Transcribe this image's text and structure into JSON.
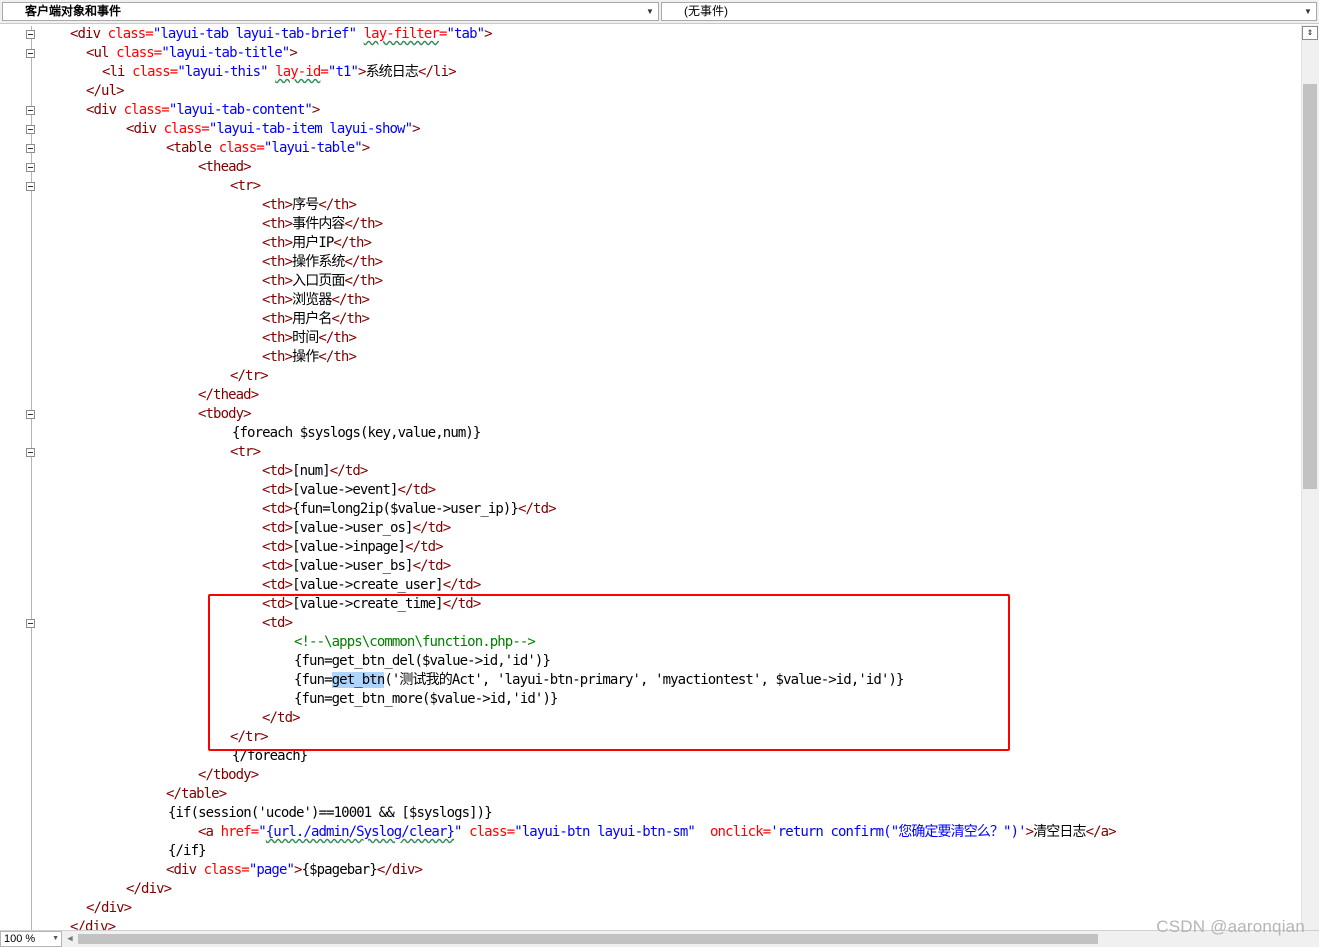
{
  "toolbar": {
    "object_dropdown": "客户端对象和事件",
    "event_dropdown": "(无事件)"
  },
  "editor": {
    "zoom_level": "100 %",
    "lines": [
      [
        [
          "tag",
          "<div "
        ],
        [
          "attr",
          "class="
        ],
        [
          "val",
          "\"layui-tab layui-tab-brief\""
        ],
        [
          "txt-b",
          " "
        ],
        [
          "attr squig",
          "lay-filter"
        ],
        [
          "attr",
          "="
        ],
        [
          "val",
          "\"tab\""
        ],
        [
          "tag",
          ">"
        ]
      ],
      [
        [
          "tag",
          "<ul "
        ],
        [
          "attr",
          "class="
        ],
        [
          "val",
          "\"layui-tab-title\""
        ],
        [
          "tag",
          ">"
        ]
      ],
      [
        [
          "tag",
          "<li "
        ],
        [
          "attr",
          "class="
        ],
        [
          "val",
          "\"layui-this\""
        ],
        [
          "txt-b",
          " "
        ],
        [
          "attr squig",
          "lay-id"
        ],
        [
          "attr",
          "="
        ],
        [
          "val",
          "\"t1\""
        ],
        [
          "tag",
          ">"
        ],
        [
          "txt-b",
          "系统日志"
        ],
        [
          "tag",
          "</li>"
        ]
      ],
      [
        [
          "tag",
          "</ul>"
        ]
      ],
      [
        [
          "tag",
          "<div "
        ],
        [
          "attr",
          "class="
        ],
        [
          "val",
          "\"layui-tab-content\""
        ],
        [
          "tag",
          ">"
        ]
      ],
      [
        [
          "tag",
          "<div "
        ],
        [
          "attr",
          "class="
        ],
        [
          "val",
          "\"layui-tab-item layui-show\""
        ],
        [
          "tag",
          ">"
        ]
      ],
      [
        [
          "tag",
          "<table "
        ],
        [
          "attr",
          "class="
        ],
        [
          "val",
          "\"layui-table\""
        ],
        [
          "tag",
          ">"
        ]
      ],
      [
        [
          "tag",
          "<thead>"
        ]
      ],
      [
        [
          "tag",
          "<tr>"
        ]
      ],
      [
        [
          "tag",
          "<th>"
        ],
        [
          "txt-b",
          "序号"
        ],
        [
          "tag",
          "</th>"
        ]
      ],
      [
        [
          "tag",
          "<th>"
        ],
        [
          "txt-b",
          "事件内容"
        ],
        [
          "tag",
          "</th>"
        ]
      ],
      [
        [
          "tag",
          "<th>"
        ],
        [
          "txt-b",
          "用户IP"
        ],
        [
          "tag",
          "</th>"
        ]
      ],
      [
        [
          "tag",
          "<th>"
        ],
        [
          "txt-b",
          "操作系统"
        ],
        [
          "tag",
          "</th>"
        ]
      ],
      [
        [
          "tag",
          "<th>"
        ],
        [
          "txt-b",
          "入口页面"
        ],
        [
          "tag",
          "</th>"
        ]
      ],
      [
        [
          "tag",
          "<th>"
        ],
        [
          "txt-b",
          "浏览器"
        ],
        [
          "tag",
          "</th>"
        ]
      ],
      [
        [
          "tag",
          "<th>"
        ],
        [
          "txt-b",
          "用户名"
        ],
        [
          "tag",
          "</th>"
        ]
      ],
      [
        [
          "tag",
          "<th>"
        ],
        [
          "txt-b",
          "时间"
        ],
        [
          "tag",
          "</th>"
        ]
      ],
      [
        [
          "tag",
          "<th>"
        ],
        [
          "txt-b",
          "操作"
        ],
        [
          "tag",
          "</th>"
        ]
      ],
      [
        [
          "tag",
          "</tr>"
        ]
      ],
      [
        [
          "tag",
          "</thead>"
        ]
      ],
      [
        [
          "tag",
          "<tbody>"
        ]
      ],
      [
        [
          "txt-b",
          "{foreach $syslogs(key,value,num)}"
        ]
      ],
      [
        [
          "tag",
          "<tr>"
        ]
      ],
      [
        [
          "tag",
          "<td>"
        ],
        [
          "txt-b",
          "[num]"
        ],
        [
          "tag",
          "</td>"
        ]
      ],
      [
        [
          "tag",
          "<td>"
        ],
        [
          "txt-b",
          "[value->event]"
        ],
        [
          "tag",
          "</td>"
        ]
      ],
      [
        [
          "tag",
          "<td>"
        ],
        [
          "txt-b",
          "{fun=long2ip($value->user_ip)}"
        ],
        [
          "tag",
          "</td>"
        ]
      ],
      [
        [
          "tag",
          "<td>"
        ],
        [
          "txt-b",
          "[value->user_os]"
        ],
        [
          "tag",
          "</td>"
        ]
      ],
      [
        [
          "tag",
          "<td>"
        ],
        [
          "txt-b",
          "[value->inpage]"
        ],
        [
          "tag",
          "</td>"
        ]
      ],
      [
        [
          "tag",
          "<td>"
        ],
        [
          "txt-b",
          "[value->user_bs]"
        ],
        [
          "tag",
          "</td>"
        ]
      ],
      [
        [
          "tag",
          "<td>"
        ],
        [
          "txt-b",
          "[value->create_user]"
        ],
        [
          "tag",
          "</td>"
        ]
      ],
      [
        [
          "tag",
          "<td>"
        ],
        [
          "txt-b",
          "[value->create_time]"
        ],
        [
          "tag",
          "</td>"
        ]
      ],
      [
        [
          "tag",
          "<td>"
        ]
      ],
      [
        [
          "cmt",
          "<!--\\apps\\common\\function.php-->"
        ]
      ],
      [
        [
          "txt-b",
          "{fun=get_btn_del($value->id,'id')}"
        ]
      ],
      [
        [
          "txt-b",
          "{fun="
        ],
        [
          "txt-b hl",
          "get_btn"
        ],
        [
          "txt-b",
          "('测试我的Act', 'layui-btn-primary', 'myactiontest', $value->id,'id')}"
        ]
      ],
      [
        [
          "txt-b",
          "{fun=get_btn_more($value->id,'id')}"
        ]
      ],
      [
        [
          "tag",
          "</td>"
        ]
      ],
      [
        [
          "tag",
          "</tr>"
        ]
      ],
      [
        [
          "txt-b",
          "{/foreach}"
        ]
      ],
      [
        [
          "tag",
          "</tbody>"
        ]
      ],
      [
        [
          "tag",
          "</table>"
        ]
      ],
      [
        [
          "txt-b",
          "{if(session('ucode')==10001 && [$syslogs])}"
        ]
      ],
      [
        [
          "tag",
          "<a "
        ],
        [
          "attr",
          "href="
        ],
        [
          "val",
          "\""
        ],
        [
          "val squig",
          "{url./admin/Syslog/clear}"
        ],
        [
          "val",
          "\""
        ],
        [
          "txt-b",
          " "
        ],
        [
          "attr",
          "class="
        ],
        [
          "val",
          "\"layui-btn layui-btn-sm\""
        ],
        [
          "txt-b",
          "  "
        ],
        [
          "attr",
          "onclick="
        ],
        [
          "val",
          "'return confirm(\"您确定要清空么？\")'"
        ],
        [
          "tag",
          ">"
        ],
        [
          "txt-b",
          "清空日志"
        ],
        [
          "tag",
          "</a>"
        ]
      ],
      [
        [
          "txt-b",
          "{/if}"
        ]
      ],
      [
        [
          "tag",
          "<div "
        ],
        [
          "attr",
          "class="
        ],
        [
          "val",
          "\"page\""
        ],
        [
          "tag",
          ">"
        ],
        [
          "txt-b",
          "{$pagebar}"
        ],
        [
          "tag",
          "</div>"
        ]
      ],
      [
        [
          "tag",
          "</div>"
        ]
      ],
      [
        [
          "tag",
          "</div>"
        ]
      ],
      [
        [
          "tag",
          "</div>"
        ]
      ]
    ]
  },
  "watermark": "CSDN @aaronqian"
}
